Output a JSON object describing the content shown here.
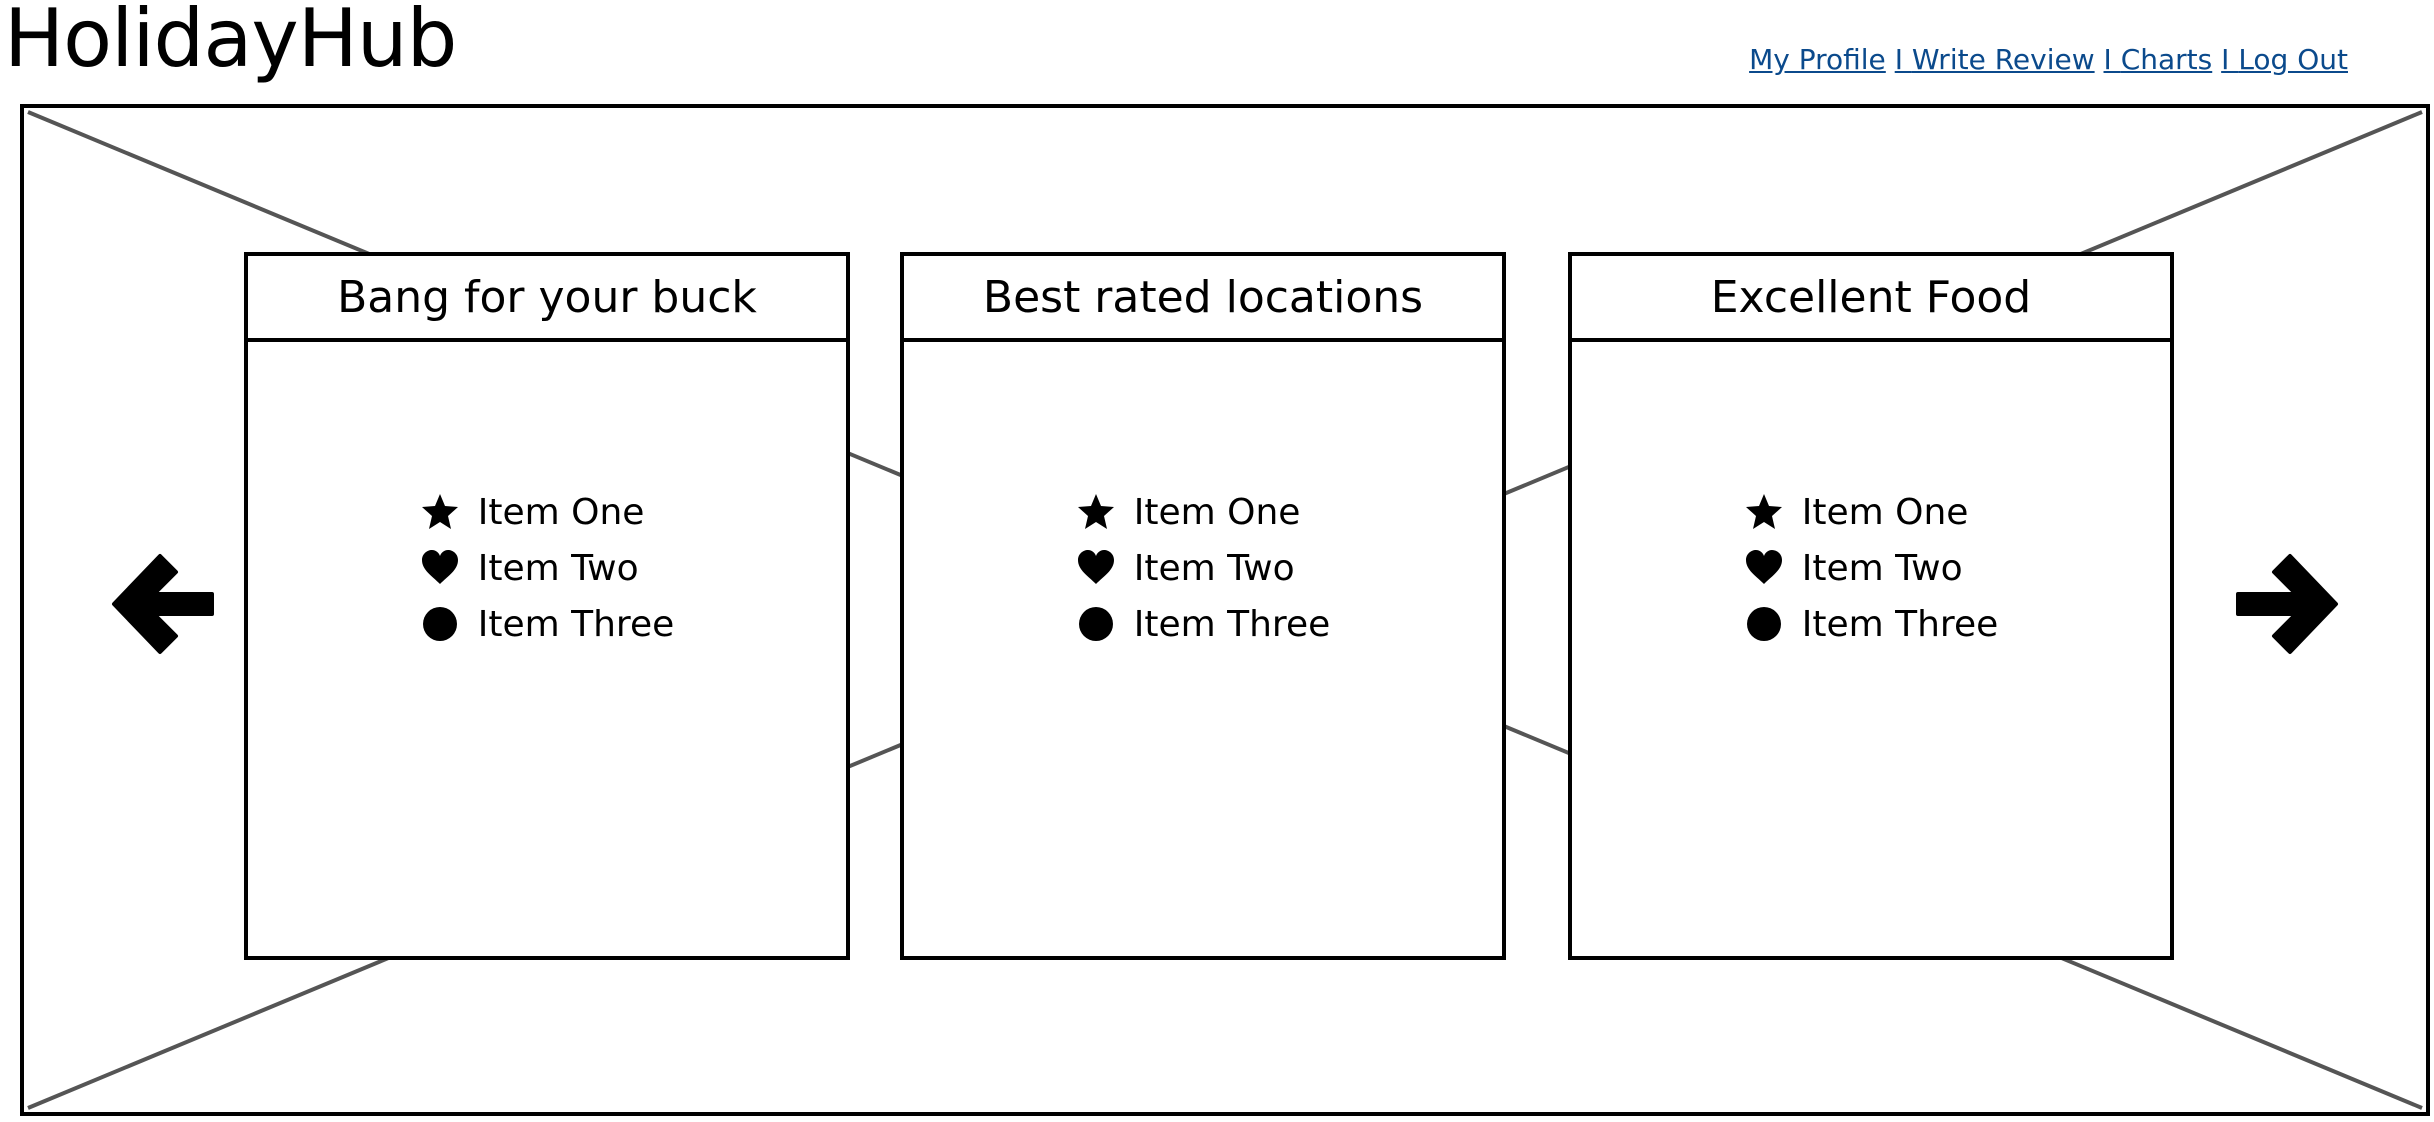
{
  "app": {
    "title": "HolidayHub"
  },
  "nav": {
    "links": [
      {
        "label": "My Profile"
      },
      {
        "label": "Write Review"
      },
      {
        "label": "Charts"
      },
      {
        "label": "Log Out"
      }
    ],
    "separator": "I"
  },
  "carousel": {
    "prev_icon": "arrow-left-icon",
    "next_icon": "arrow-right-icon",
    "cards": [
      {
        "title": "Bang for your buck",
        "items": [
          {
            "label": "Item One",
            "icon": "star-icon"
          },
          {
            "label": "Item Two",
            "icon": "heart-icon"
          },
          {
            "label": "Item Three",
            "icon": "circle-icon"
          }
        ]
      },
      {
        "title": "Best rated locations",
        "items": [
          {
            "label": "Item One",
            "icon": "star-icon"
          },
          {
            "label": "Item Two",
            "icon": "heart-icon"
          },
          {
            "label": "Item Three",
            "icon": "circle-icon"
          }
        ]
      },
      {
        "title": "Excellent Food",
        "items": [
          {
            "label": "Item One",
            "icon": "star-icon"
          },
          {
            "label": "Item Two",
            "icon": "heart-icon"
          },
          {
            "label": "Item Three",
            "icon": "circle-icon"
          }
        ]
      }
    ]
  },
  "colors": {
    "link": "#0b4a8c",
    "border": "#000000",
    "placeholder_lines": "#555555"
  }
}
